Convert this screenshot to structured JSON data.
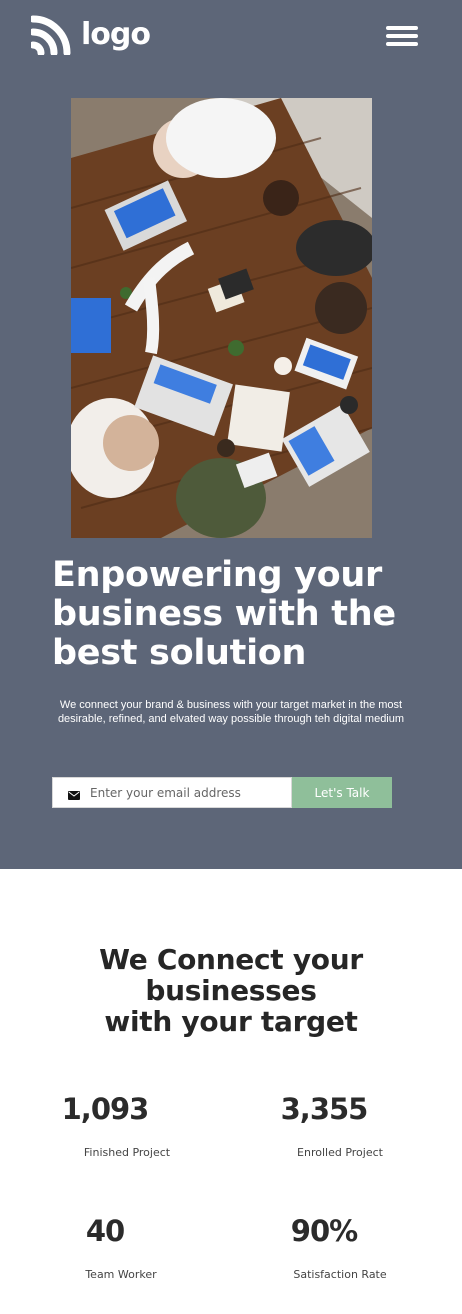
{
  "header": {
    "logo_text": "logo",
    "logo_icon": "wifi-arcs-logo-icon",
    "menu_icon": "hamburger-menu-icon"
  },
  "hero": {
    "background_color": "#5d6678",
    "headline_lines": [
      "Enpowering your",
      "business with the",
      "best solution"
    ],
    "subtext": "We connect your brand & business with your target market in the most desirable, refined, and elvated way possible through teh digital medium",
    "email_placeholder": "Enter your email address",
    "email_icon": "envelope-icon",
    "cta_label": "Let's Talk",
    "cta_color": "#8fbf9a"
  },
  "connect": {
    "title_lines": [
      "We Connect your",
      "businesses",
      "with your target"
    ]
  },
  "stats": [
    {
      "value": "1,093",
      "label": "Finished Project"
    },
    {
      "value": "3,355",
      "label": "Enrolled Project"
    },
    {
      "value": "40",
      "label": "Team Worker"
    },
    {
      "value": "90%",
      "label": "Satisfaction Rate"
    }
  ]
}
